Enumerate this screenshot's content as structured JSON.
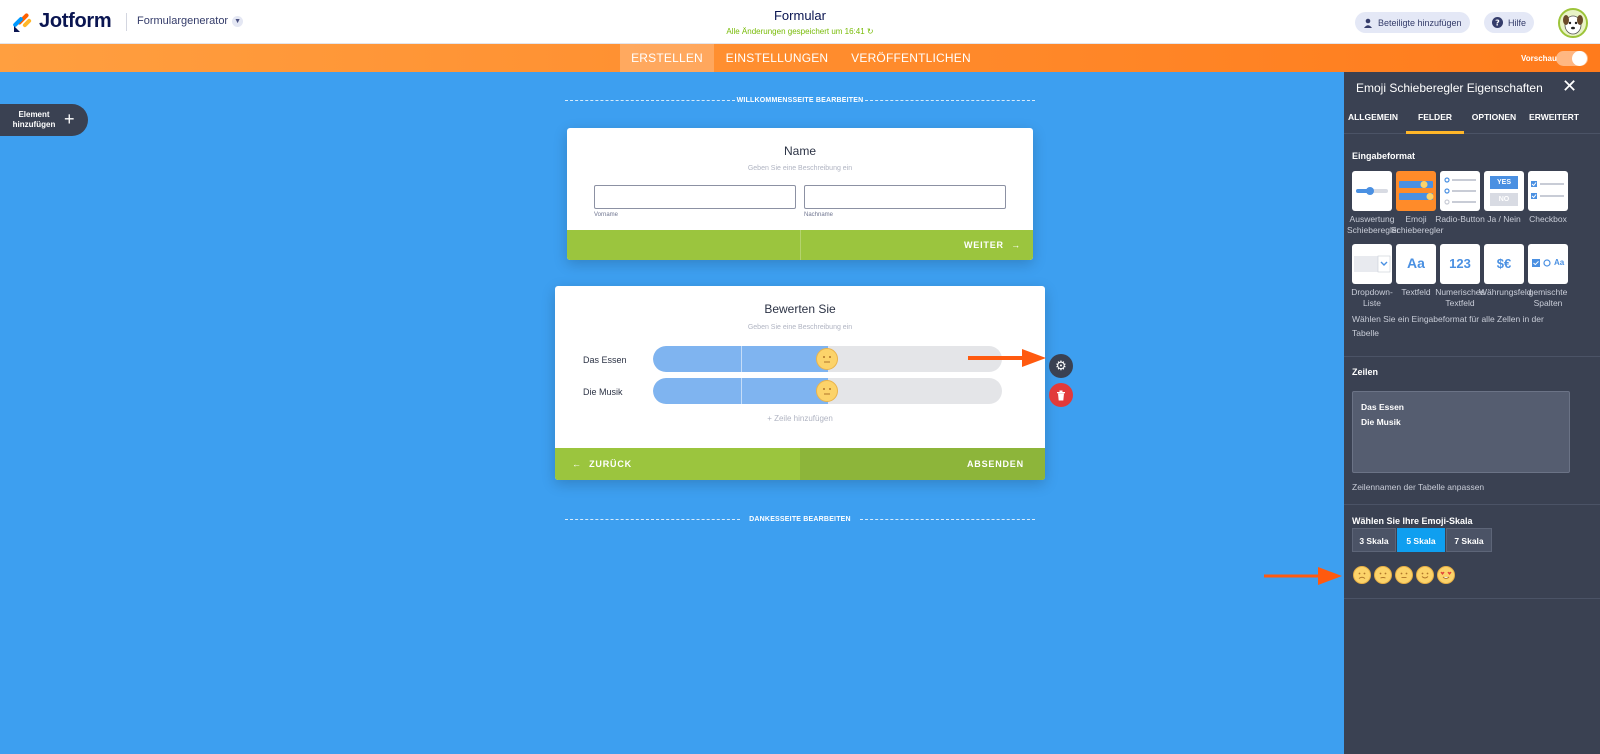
{
  "header": {
    "brand": "Jotform",
    "generator": "Formulargenerator",
    "form_title": "Formular",
    "saved_status": "Alle Änderungen gespeichert um 16:41",
    "add_people": "Beteiligte hinzufügen",
    "help": "Hilfe"
  },
  "nav": {
    "tabs": [
      "ERSTELLEN",
      "EINSTELLUNGEN",
      "VERÖFFENTLICHEN"
    ],
    "active_tab": "ERSTELLEN",
    "preview": "Vorschau"
  },
  "canvas": {
    "add_element": "Element hinzufügen",
    "welcome_edit": "WILLKOMMENSSEITE BEARBEITEN",
    "thanks_edit": "DANKESSEITE BEARBEITEN",
    "name_card": {
      "title": "Name",
      "description": "Geben Sie eine Beschreibung ein",
      "first_label": "Vorname",
      "last_label": "Nachname",
      "next_button": "WEITER"
    },
    "rating_card": {
      "title": "Bewerten Sie",
      "description": "Geben Sie eine Beschreibung ein",
      "rows": [
        {
          "label": "Das Essen",
          "value": 0.5
        },
        {
          "label": "Die Musik",
          "value": 0.5
        }
      ],
      "add_row": "+ Zeile hinzufügen",
      "back_button": "ZURÜCK",
      "submit_button": "ABSENDEN"
    }
  },
  "panel": {
    "title": "Emoji Schieberegler Eigenschaften",
    "tabs": [
      "ALLGEMEIN",
      "FELDER",
      "OPTIONEN",
      "ERWEITERT"
    ],
    "active_tab": "FELDER",
    "input_format_title": "Eingabeformat",
    "formats": [
      {
        "label": "Auswertung Schieberegler",
        "icon": "slider-icon",
        "selected": false
      },
      {
        "label": "Emoji Schieberegler",
        "icon": "emoji-slider-icon",
        "selected": true
      },
      {
        "label": "Radio-Button",
        "icon": "radio-icon",
        "selected": false
      },
      {
        "label": "Ja / Nein",
        "icon": "yes-no-icon",
        "selected": false
      },
      {
        "label": "Checkbox",
        "icon": "checkbox-icon",
        "selected": false
      },
      {
        "label": "Dropdown-Liste",
        "icon": "dropdown-icon",
        "selected": false
      },
      {
        "label": "Textfeld",
        "icon": "textfield-icon",
        "selected": false
      },
      {
        "label": "Numerisches Textfeld",
        "icon": "numeric-icon",
        "selected": false
      },
      {
        "label": "Währungsfeld",
        "icon": "currency-icon",
        "selected": false
      },
      {
        "label": "gemischte Spalten",
        "icon": "mixed-columns-icon",
        "selected": false
      }
    ],
    "format_icon_text": {
      "yes": "YES",
      "no": "NO",
      "text": "Aa",
      "numeric": "123",
      "currency": "$€",
      "mixed": "Aa"
    },
    "format_help": "Wählen Sie ein Eingabeformat für alle Zellen in der Tabelle",
    "rows_title": "Zeilen",
    "rows_text": [
      "Das Essen",
      "Die Musik"
    ],
    "rows_help": "Zeilennamen der Tabelle anpassen",
    "scale_title": "Wählen Sie Ihre Emoji-Skala",
    "scales": [
      "3 Skala",
      "5 Skala",
      "7 Skala"
    ],
    "active_scale": "5 Skala"
  },
  "colors": {
    "canvas_bg": "#3d9ff0",
    "nav_orange": "#ff7b1c",
    "panel_bg": "#3a4152",
    "footer_green": "#9bc53e",
    "accent_blue": "#0f9ff0",
    "arrow_orange": "#ff5a0f"
  }
}
